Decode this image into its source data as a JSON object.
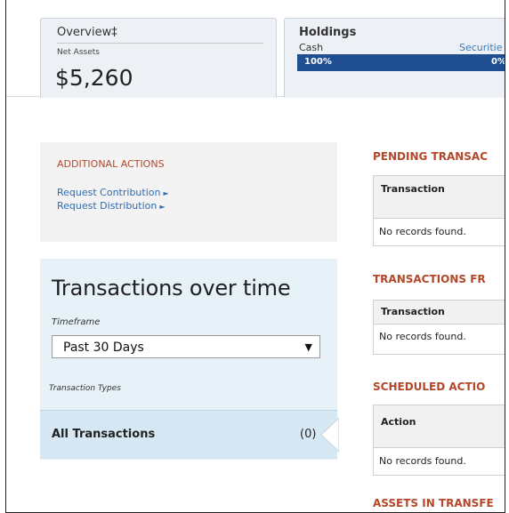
{
  "summary": {
    "overview": {
      "title": "Overview‡",
      "net_label": "Net Assets",
      "net_value": "$5,260"
    },
    "holdings": {
      "title": "Holdings",
      "cash_label": "Cash",
      "securities_label": "Securitie",
      "cash_pct": "100%",
      "securities_pct": "0%",
      "cash_fraction": 1.0,
      "bar_color": "#1f4e91"
    }
  },
  "additional_actions": {
    "title": "ADDITIONAL ACTIONS",
    "links": [
      {
        "label": "Request Contribution",
        "icon": "play-arrow-icon"
      },
      {
        "label": "Request Distribution",
        "icon": "play-arrow-icon"
      }
    ]
  },
  "transactions_over_time": {
    "title": "Transactions over time",
    "timeframe_label": "Timeframe",
    "timeframe_value": "Past 30 Days",
    "types_label": "Transaction Types",
    "all_label": "All Transactions",
    "all_count": "(0)"
  },
  "sections": {
    "pending": {
      "title": "PENDING TRANSAC",
      "column": "Transaction",
      "empty": "No records found."
    },
    "transactions_from": {
      "title": "TRANSACTIONS FR",
      "column": "Transaction",
      "empty": "No records found."
    },
    "scheduled": {
      "title": "SCHEDULED ACTIO",
      "column": "Action",
      "empty": "No records found."
    },
    "assets_in_transfer": {
      "title": "ASSETS IN TRANSFE"
    }
  },
  "colors": {
    "accent_red": "#b3472a",
    "link_blue": "#2f6bb0",
    "panel_blue": "#e6f1f8"
  }
}
